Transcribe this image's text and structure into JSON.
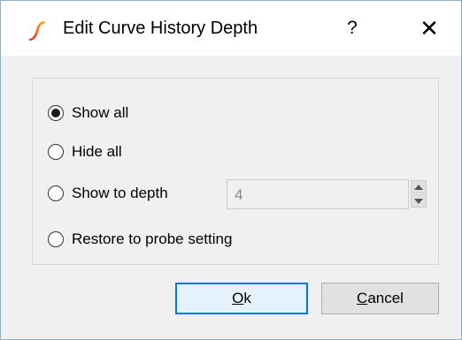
{
  "window": {
    "title": "Edit Curve History Depth",
    "help_label": "?",
    "close_label": "✕",
    "icon": "app-logo-icon"
  },
  "options": {
    "show_all": {
      "label": "Show all",
      "checked": true
    },
    "hide_all": {
      "label": "Hide all",
      "checked": false
    },
    "show_to_depth": {
      "label": "Show to depth",
      "checked": false,
      "depth_value": "4"
    },
    "restore": {
      "label": "Restore to probe setting",
      "checked": false
    }
  },
  "buttons": {
    "ok": {
      "mnemonic": "O",
      "rest": "k"
    },
    "cancel": {
      "mnemonic": "C",
      "rest": "ancel"
    }
  },
  "colors": {
    "accent": "#0078d7",
    "logo_red": "#e8281e",
    "logo_yellow": "#f6b51b"
  }
}
